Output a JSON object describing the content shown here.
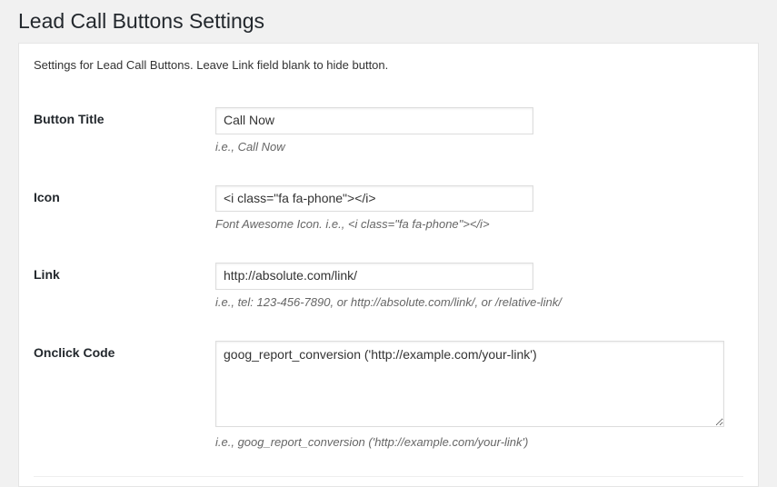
{
  "page": {
    "title": "Lead Call Buttons Settings",
    "intro": "Settings for Lead Call Buttons. Leave Link field blank to hide button."
  },
  "fields": {
    "button_title": {
      "label": "Button Title",
      "value": "Call Now",
      "hint": "i.e., Call Now"
    },
    "icon": {
      "label": "Icon",
      "value": "<i class=\"fa fa-phone\"></i>",
      "hint": "Font Awesome Icon. i.e., <i class=\"fa fa-phone\"></i>"
    },
    "link": {
      "label": "Link",
      "value": "http://absolute.com/link/",
      "hint": "i.e., tel: 123-456-7890, or http://absolute.com/link/, or /relative-link/"
    },
    "onclick": {
      "label": "Onclick Code",
      "value": "goog_report_conversion ('http://example.com/your-link')",
      "hint": "i.e., goog_report_conversion ('http://example.com/your-link')"
    }
  }
}
